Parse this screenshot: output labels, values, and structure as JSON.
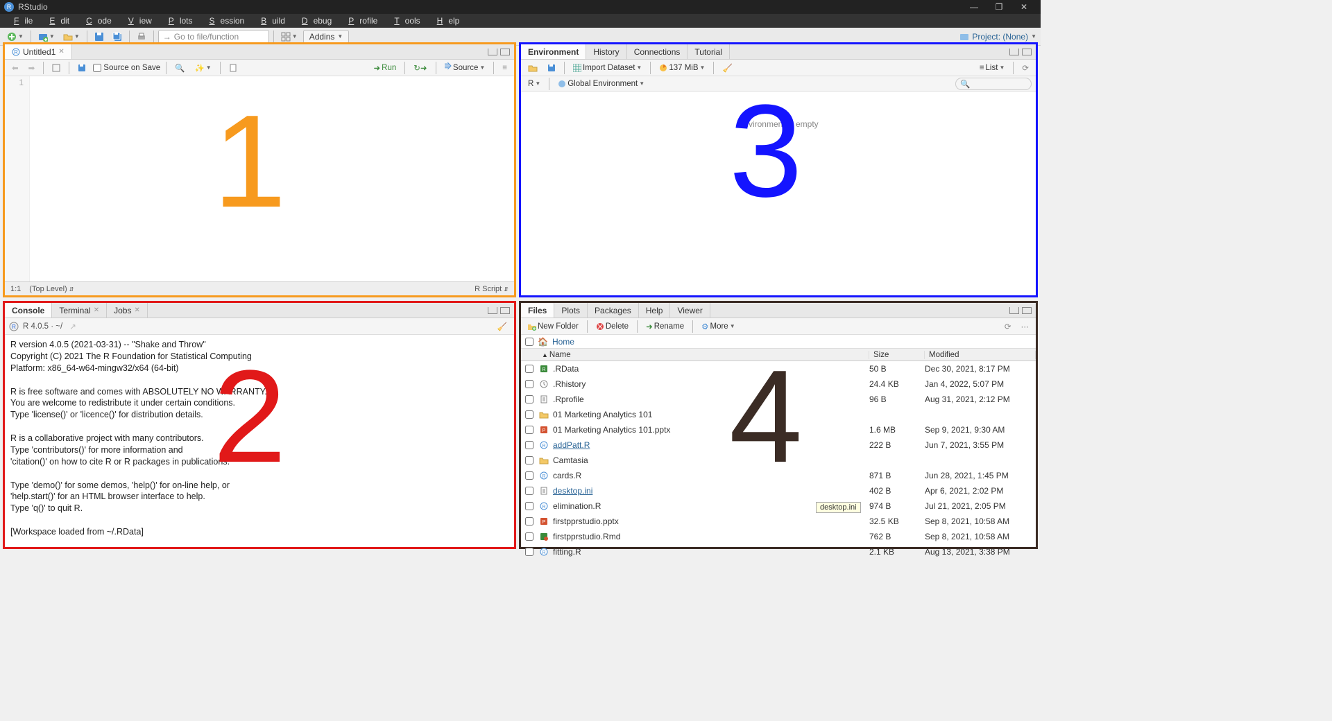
{
  "app": {
    "title": "RStudio"
  },
  "menu": [
    "File",
    "Edit",
    "Code",
    "View",
    "Plots",
    "Session",
    "Build",
    "Debug",
    "Profile",
    "Tools",
    "Help"
  ],
  "toolbar": {
    "goto": "Go to file/function",
    "addins": "Addins",
    "project": "Project: (None)"
  },
  "pane1": {
    "tab": "Untitled1",
    "sourceOnSave": "Source on Save",
    "run": "Run",
    "source": "Source",
    "line": "1",
    "status_pos": "1:1",
    "status_scope": "(Top Level)",
    "status_lang": "R Script"
  },
  "pane2": {
    "tabs": [
      "Console",
      "Terminal",
      "Jobs"
    ],
    "version": "R 4.0.5 · ~/",
    "text": "R version 4.0.5 (2021-03-31) -- \"Shake and Throw\"\nCopyright (C) 2021 The R Foundation for Statistical Computing\nPlatform: x86_64-w64-mingw32/x64 (64-bit)\n\nR is free software and comes with ABSOLUTELY NO WARRANTY.\nYou are welcome to redistribute it under certain conditions.\nType 'license()' or 'licence()' for distribution details.\n\nR is a collaborative project with many contributors.\nType 'contributors()' for more information and\n'citation()' on how to cite R or R packages in publications.\n\nType 'demo()' for some demos, 'help()' for on-line help, or\n'help.start()' for an HTML browser interface to help.\nType 'q()' to quit R.\n\n[Workspace loaded from ~/.RData]\n",
    "prompt": "> "
  },
  "pane3": {
    "tabs": [
      "Environment",
      "History",
      "Connections",
      "Tutorial"
    ],
    "import": "Import Dataset",
    "mem": "137 MiB",
    "view": "List",
    "scope_r": "R",
    "scope_env": "Global Environment",
    "empty": "Environment is empty"
  },
  "pane4": {
    "tabs": [
      "Files",
      "Plots",
      "Packages",
      "Help",
      "Viewer"
    ],
    "btns": {
      "newfolder": "New Folder",
      "delete": "Delete",
      "rename": "Rename",
      "more": "More"
    },
    "home": "Home",
    "cols": {
      "name": "Name",
      "size": "Size",
      "modified": "Modified"
    },
    "files": [
      {
        "icon": "rdata",
        "name": ".RData",
        "size": "50 B",
        "mod": "Dec 30, 2021, 8:17 PM"
      },
      {
        "icon": "hist",
        "name": ".Rhistory",
        "size": "24.4 KB",
        "mod": "Jan 4, 2022, 5:07 PM"
      },
      {
        "icon": "txt",
        "name": ".Rprofile",
        "size": "96 B",
        "mod": "Aug 31, 2021, 2:12 PM"
      },
      {
        "icon": "folder",
        "name": "01 Marketing Analytics 101",
        "size": "",
        "mod": ""
      },
      {
        "icon": "pptx",
        "name": "01 Marketing Analytics 101.pptx",
        "size": "1.6 MB",
        "mod": "Sep 9, 2021, 9:30 AM"
      },
      {
        "icon": "rfile",
        "name": "addPatt.R",
        "link": true,
        "size": "222 B",
        "mod": "Jun 7, 2021, 3:55 PM"
      },
      {
        "icon": "folder",
        "name": "Camtasia",
        "size": "",
        "mod": ""
      },
      {
        "icon": "rfile",
        "name": "cards.R",
        "size": "871 B",
        "mod": "Jun 28, 2021, 1:45 PM"
      },
      {
        "icon": "txt",
        "name": "desktop.ini",
        "link": true,
        "size": "402 B",
        "mod": "Apr 6, 2021, 2:02 PM"
      },
      {
        "icon": "rfile",
        "name": "elimination.R",
        "size": "974 B",
        "mod": "Jul 21, 2021, 2:05 PM"
      },
      {
        "icon": "pptx",
        "name": "firstpprstudio.pptx",
        "size": "32.5 KB",
        "mod": "Sep 8, 2021, 10:58 AM"
      },
      {
        "icon": "rmd",
        "name": "firstpprstudio.Rmd",
        "size": "762 B",
        "mod": "Sep 8, 2021, 10:58 AM"
      },
      {
        "icon": "rfile",
        "name": "fitting.R",
        "size": "2.1 KB",
        "mod": "Aug 13, 2021, 3:38 PM"
      }
    ],
    "tooltip": "desktop.ini"
  }
}
